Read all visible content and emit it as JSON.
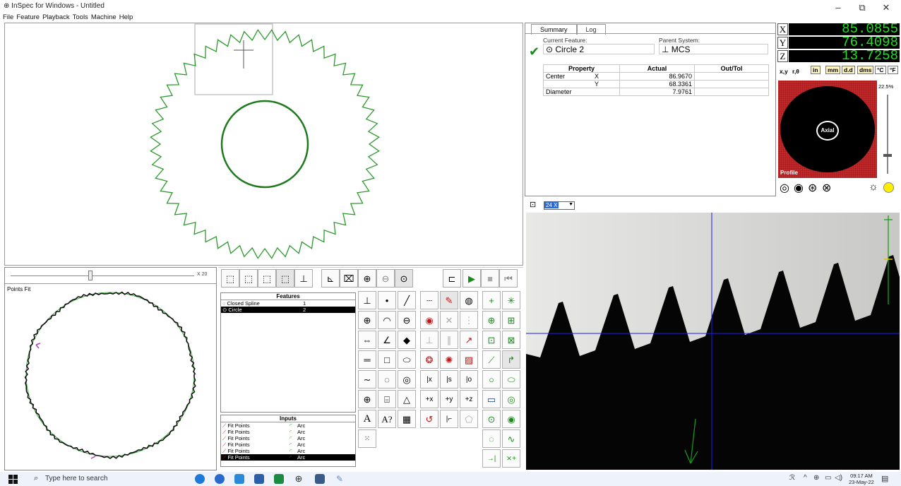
{
  "window": {
    "title": "InSpec for Windows - Untitled"
  },
  "window_controls": {
    "minimize": "–",
    "restore": "⧉",
    "close": "✕"
  },
  "menu": [
    "File",
    "Feature",
    "Playback",
    "Tools",
    "Machine",
    "Help"
  ],
  "summary": {
    "tabs": [
      "Summary",
      "Log"
    ],
    "current_feature_label": "Current Feature:",
    "current_feature": "Circle 2",
    "parent_system_label": "Parent System:",
    "parent_system": "MCS",
    "table_headers": [
      "Property",
      "Actual",
      "Out/Tol"
    ],
    "rows": [
      {
        "property": "Center",
        "axis": "X",
        "actual": "86.9670",
        "out_tol": ""
      },
      {
        "property": "",
        "axis": "Y",
        "actual": "68.3361",
        "out_tol": ""
      },
      {
        "property": "Diameter",
        "axis": "",
        "actual": "7.9761",
        "out_tol": ""
      }
    ]
  },
  "dro": {
    "x_label": "X",
    "x": "85.0855",
    "y_label": "Y",
    "y": "76.4098",
    "z_label": "Z",
    "z": "13.7258",
    "buttons": [
      "x,y",
      "r,θ",
      "in",
      "mm",
      "d.d",
      "dms",
      "°C",
      "°F"
    ]
  },
  "lighting": {
    "center_label": "Axial",
    "mode_label": "Profile",
    "percent": "22.5%",
    "level": 0.225
  },
  "camera": {
    "zoom": "24 X"
  },
  "points_fit": {
    "title": "Points Fit",
    "zoom_label": "X 20"
  },
  "features": {
    "header": "Features",
    "items": [
      {
        "name": "Closed Spline",
        "count": "1"
      },
      {
        "name": "Circle",
        "count": "2"
      }
    ]
  },
  "inputs": {
    "header": "Inputs",
    "items": [
      {
        "left": "Fit Points",
        "right": "Arc"
      },
      {
        "left": "Fit Points",
        "right": "Arc"
      },
      {
        "left": "Fit Points",
        "right": "Arc"
      },
      {
        "left": "Fit Points",
        "right": "Arc"
      },
      {
        "left": "Fit Points",
        "right": "Arc"
      },
      {
        "left": "Fit Points",
        "right": "Arc"
      }
    ]
  },
  "taskbar": {
    "search_placeholder": "Type here to search",
    "time": "09:17 AM",
    "date": "23-May-22"
  },
  "colors": {
    "gear": "#2e9a2e",
    "circle": "#1e7a1e",
    "dro_bg": "#000000",
    "dro_text": "#22dd22",
    "light_bg": "#c0282a",
    "crosshair": "#1a1aff"
  }
}
